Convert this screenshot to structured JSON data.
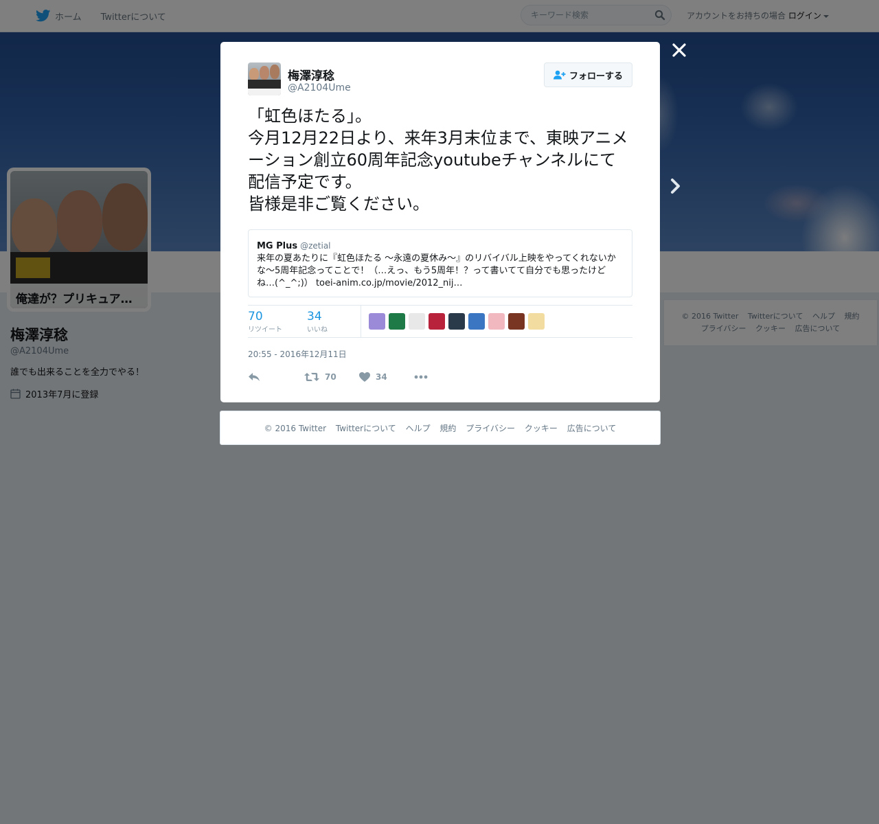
{
  "nav": {
    "home_label": "ホーム",
    "about_label": "Twitterについて",
    "search_placeholder": "キーワード検索",
    "login_prefix": "アカウントをお持ちの場合",
    "login_label": "ログイン"
  },
  "profile": {
    "avatar_caption": "俺達が？プリキュア…",
    "name": "梅澤淳稔",
    "handle": "@A2104Ume",
    "bio": "誰でも出来ることを全力でやる！",
    "joined": "2013年7月に登録"
  },
  "tweet": {
    "author_name": "梅澤淳稔",
    "author_handle": "@A2104Ume",
    "follow_label": "フォローする",
    "text": "「虹色ほたる」。\n今月12月22日より、来年3月末位まで、東映アニメーション創立60周年記念youtubeチャンネルにて配信予定です。\n皆様是非ご覧ください。",
    "quote": {
      "name": "MG Plus",
      "handle": "@zetial",
      "text": "来年の夏あたりに『虹色ほたる 〜永遠の夏休み〜』のリバイバル上映をやってくれないかな〜5周年記念ってことで！（…えっ、もう5周年！？って書いてて自分でも思ったけどね…(^_^;)） toei-anim.co.jp/movie/2012_nij…"
    },
    "retweets": "70",
    "retweets_label": "リツイート",
    "likes": "34",
    "likes_label": "いいね",
    "timestamp": "20:55 - 2016年12月11日",
    "action_retweet_count": "70",
    "action_like_count": "34"
  },
  "likers_colors": [
    "#9b8ad8",
    "#1e7a46",
    "#e8e8e8",
    "#b8223a",
    "#2a3a4a",
    "#3a76c2",
    "#f2b8c0",
    "#7a3422",
    "#f3dca0"
  ],
  "footer": {
    "copyright": "© 2016 Twitter",
    "about": "Twitterについて",
    "help": "ヘルプ",
    "terms": "規約",
    "privacy": "プライバシー",
    "cookies": "クッキー",
    "ads": "広告について"
  },
  "colors": {
    "accent": "#1da1f2",
    "link_blue": "#1b95e0",
    "muted": "#657786"
  }
}
